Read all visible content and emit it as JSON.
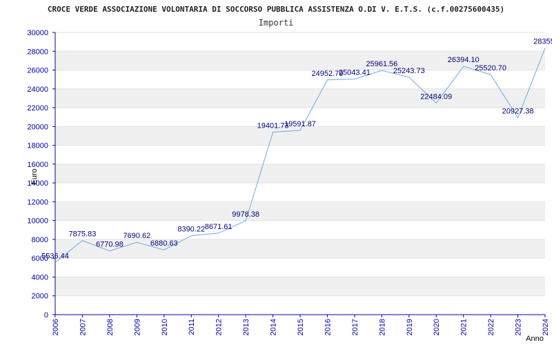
{
  "chart_data": {
    "type": "line",
    "title": "CROCE VERDE ASSOCIAZIONE VOLONTARIA DI SOCCORSO PUBBLICA ASSISTENZA O.DI V. E.T.S. (c.f.00275600435)",
    "subtitle": "Importi",
    "xlabel": "Anno",
    "ylabel": "Euro",
    "ylim": [
      0,
      30000
    ],
    "yticks": [
      "0",
      "2000",
      "4000",
      "6000",
      "8000",
      "10000",
      "12000",
      "14000",
      "16000",
      "18000",
      "20000",
      "22000",
      "24000",
      "26000",
      "28000",
      "30000"
    ],
    "x": [
      "2006",
      "2007",
      "2008",
      "2009",
      "2010",
      "2011",
      "2012",
      "2013",
      "2014",
      "2015",
      "2016",
      "2017",
      "2018",
      "2019",
      "2020",
      "2021",
      "2022",
      "2023",
      "2024"
    ],
    "values": [
      5536.44,
      7875.83,
      6770.98,
      7690.62,
      6880.63,
      8390.22,
      8671.61,
      9978.38,
      19401.73,
      19591.87,
      24952.79,
      25043.41,
      25961.56,
      25243.73,
      22484.09,
      26394.1,
      25520.7,
      20927.38,
      28355.0
    ],
    "data_labels": [
      "5536.44",
      "7875.83",
      "6770.98",
      "7690.62",
      "6880.63",
      "8390.22",
      "8671.61",
      "9978.38",
      "19401.73",
      "19591.87",
      "24952.79",
      "25043.41",
      "25961.56",
      "25243.73",
      "22484.09",
      "26394.10",
      "25520.70",
      "20927.38",
      "28355."
    ],
    "grid": true,
    "line_color": "#6aaae6",
    "band_color": "#f0f0f0",
    "tick_color": "#0000aa",
    "label_color": "#000080"
  }
}
